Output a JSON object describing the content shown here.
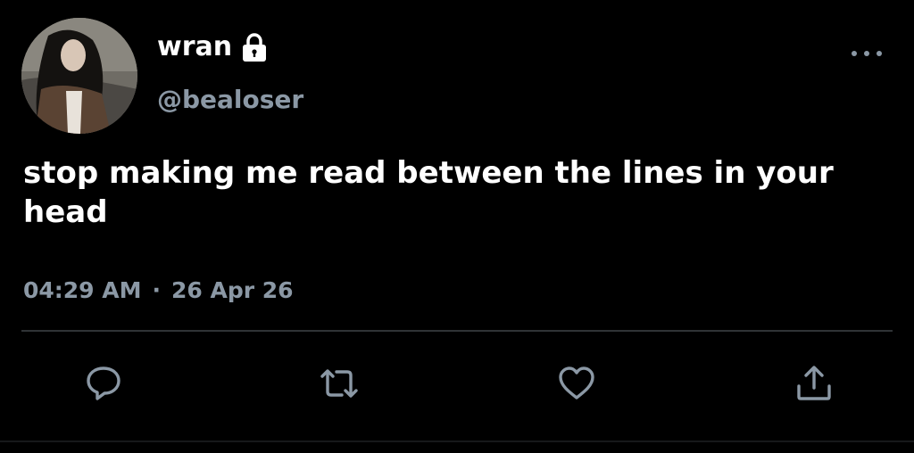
{
  "tweet": {
    "author": {
      "display_name": "wran",
      "handle": "@bealoser",
      "protected_icon": "lock-icon",
      "avatar_alt": "profile photo"
    },
    "text": "stop making me read between the lines in your head",
    "time": "04:29 AM",
    "separator": "·",
    "date": "26 Apr 26",
    "menu_icon": "more-horizontal-icon"
  },
  "actions": [
    {
      "name": "reply",
      "icon": "reply-icon"
    },
    {
      "name": "retweet",
      "icon": "retweet-icon"
    },
    {
      "name": "like",
      "icon": "heart-icon"
    },
    {
      "name": "share",
      "icon": "share-icon"
    }
  ],
  "colors": {
    "background": "#000000",
    "primary_text": "#ffffff",
    "secondary_text": "#8b98a5",
    "divider": "#2f3336"
  }
}
